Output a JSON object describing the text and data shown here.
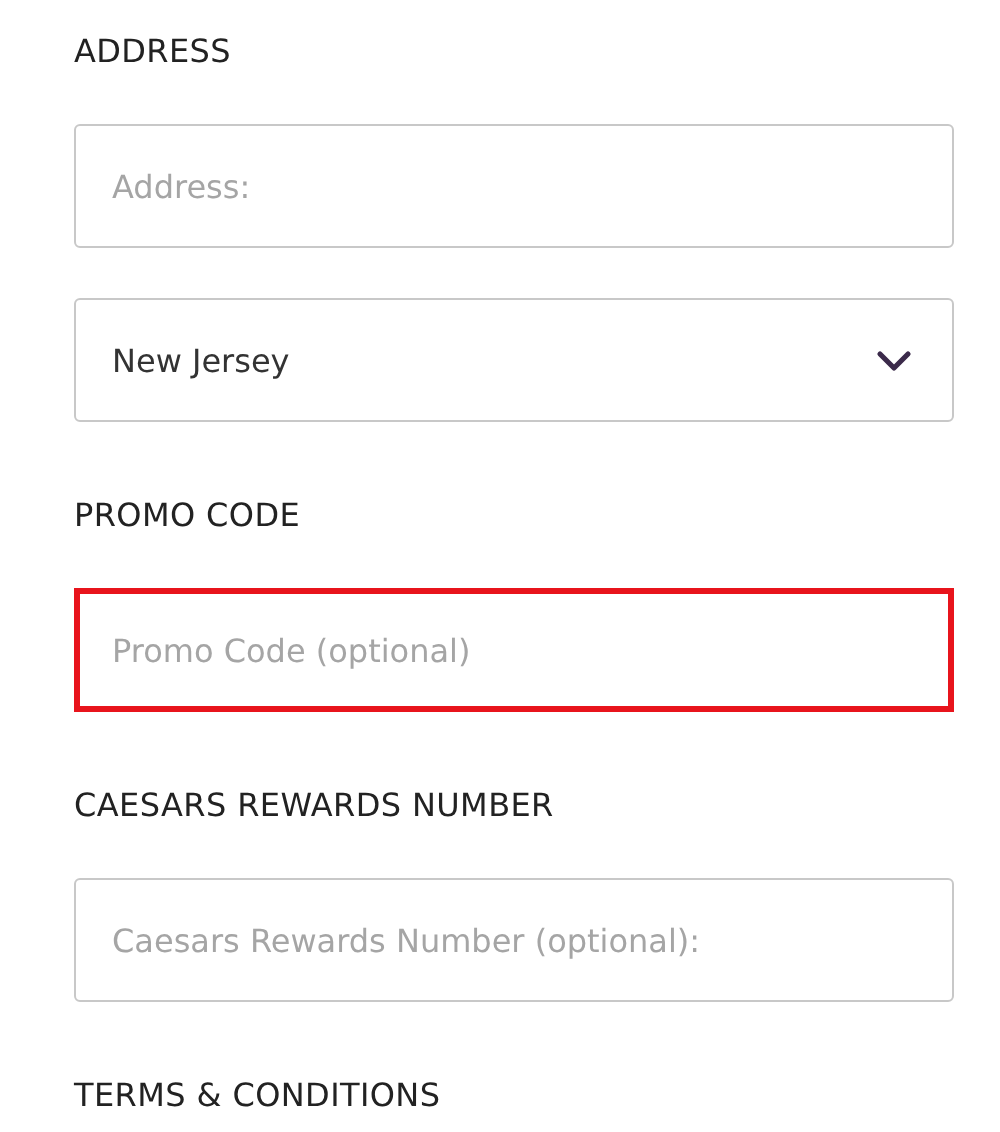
{
  "sections": [
    {
      "heading": "ADDRESS",
      "controls": [
        {
          "kind": "input",
          "placeholder": "Address:",
          "highlighted": false
        },
        {
          "kind": "select",
          "value": "New Jersey",
          "highlighted": false
        }
      ]
    },
    {
      "heading": "PROMO CODE",
      "controls": [
        {
          "kind": "input",
          "placeholder": "Promo Code (optional)",
          "highlighted": true
        }
      ]
    },
    {
      "heading": "CAESARS REWARDS NUMBER",
      "controls": [
        {
          "kind": "input",
          "placeholder": "Caesars Rewards Number (optional):",
          "highlighted": false
        }
      ]
    },
    {
      "heading": "TERMS & CONDITIONS"
    }
  ]
}
